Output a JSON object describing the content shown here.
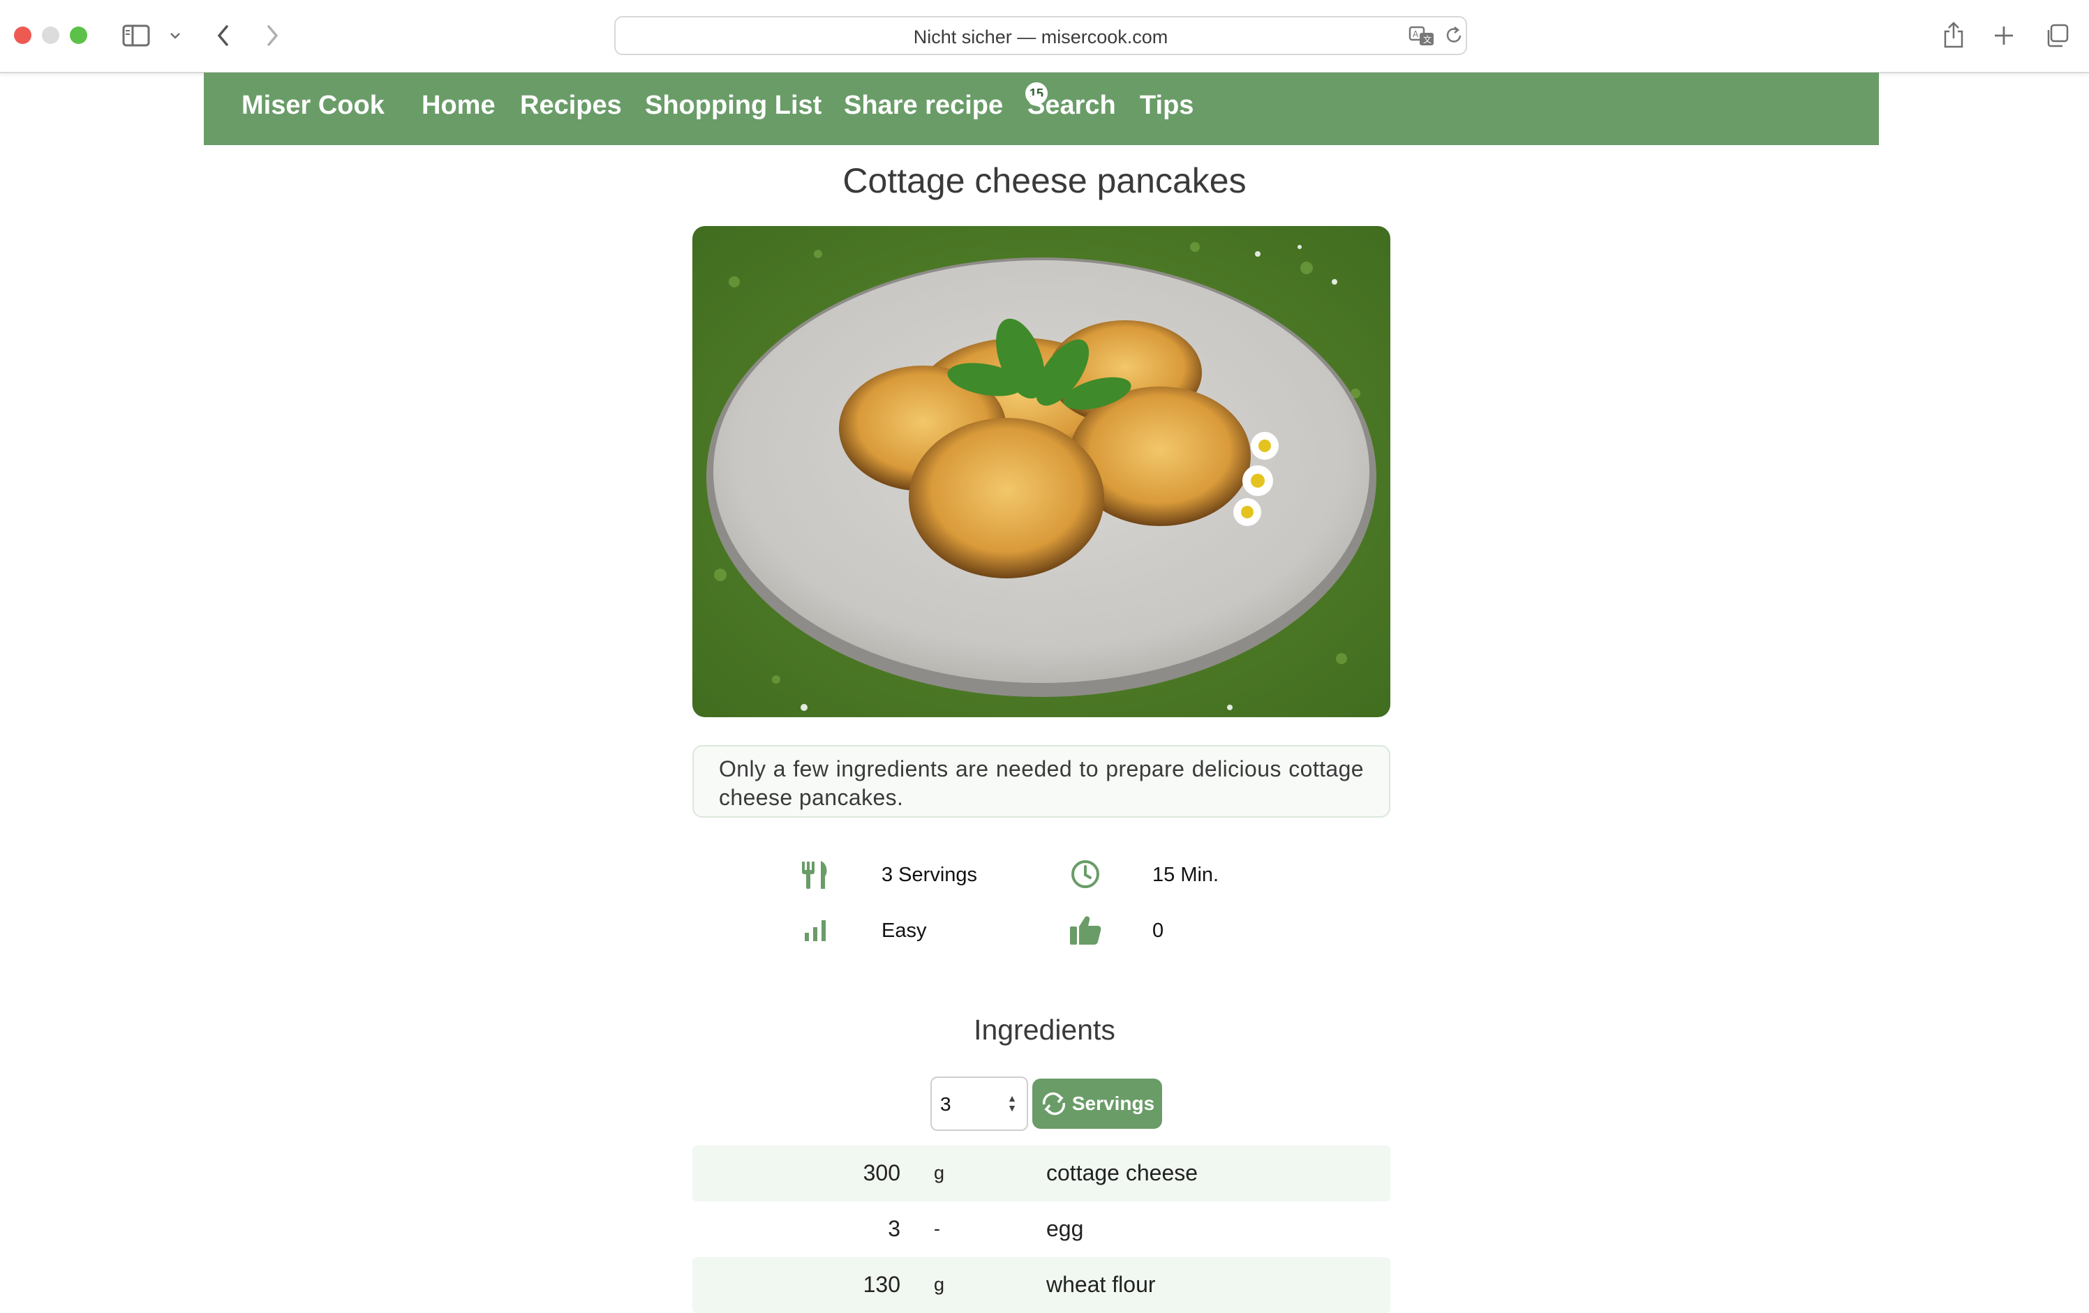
{
  "browser": {
    "address": "Nicht sicher — misercook.com"
  },
  "nav": {
    "brand": "Miser Cook",
    "items": [
      "Home",
      "Recipes",
      "Shopping List",
      "Share recipe",
      "Search",
      "Tips"
    ],
    "shopping_badge": "15"
  },
  "recipe": {
    "title": "Cottage cheese pancakes",
    "description": "Only a few ingredients are needed to prepare delicious cottage cheese pancakes.",
    "servings": "3 Servings",
    "time": "15 Min.",
    "difficulty": "Easy",
    "likes": "0"
  },
  "ingredients": {
    "title": "Ingredients",
    "servings_value": "3",
    "servings_button": "Servings",
    "rows": [
      {
        "amount": "300",
        "unit": "g",
        "name": "cottage cheese"
      },
      {
        "amount": "3",
        "unit": "-",
        "name": "egg"
      },
      {
        "amount": "130",
        "unit": "g",
        "name": "wheat flour"
      }
    ]
  },
  "colors": {
    "accent": "#6a9c68",
    "row_shade": "#f1f7f1"
  },
  "icons": [
    "sidebar-icon",
    "chevron-down-icon",
    "back-icon",
    "forward-icon",
    "translate-icon",
    "reload-icon",
    "share-icon",
    "plus-icon",
    "tabs-icon",
    "fork-knife-icon",
    "clock-icon",
    "bar-chart-icon",
    "thumbs-up-icon",
    "refresh-icon"
  ]
}
